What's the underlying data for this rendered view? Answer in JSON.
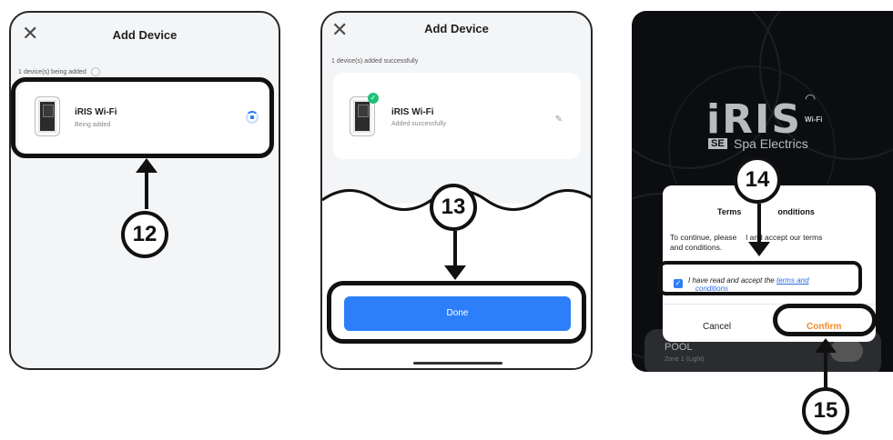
{
  "panel1": {
    "title": "Add Device",
    "status": "1 device(s) being added",
    "device_name": "iRIS Wi-Fi",
    "device_status": "Being added",
    "step": "12"
  },
  "panel2": {
    "title": "Add Device",
    "status": "1 device(s) added successfully",
    "device_name": "iRIS Wi-Fi",
    "device_status": "Added successfully",
    "done_label": "Done",
    "step": "13"
  },
  "panel3": {
    "logo_text": "iRIS",
    "logo_wifi": "Wi-Fi",
    "brand_mark": "SE",
    "brand_text": "Spa Electrics",
    "modal_title_left": "Terms",
    "modal_title_right": "onditions",
    "body_line1_a": "To continue, please",
    "body_line1_b": "l and accept our terms",
    "body_line2": "and conditions.",
    "accept_text": "I have read and accept the",
    "terms_link": "terms and",
    "terms_link2": "conditions",
    "cancel_label": "Cancel",
    "confirm_label": "Confirm",
    "zone_title": "POOL",
    "zone_sub": "Zone 1 (Light)",
    "step_a": "14",
    "step_b": "15"
  },
  "colors": {
    "accent_blue": "#2d7ff9",
    "confirm_orange": "#f28a24",
    "success_green": "#1fc27a"
  }
}
